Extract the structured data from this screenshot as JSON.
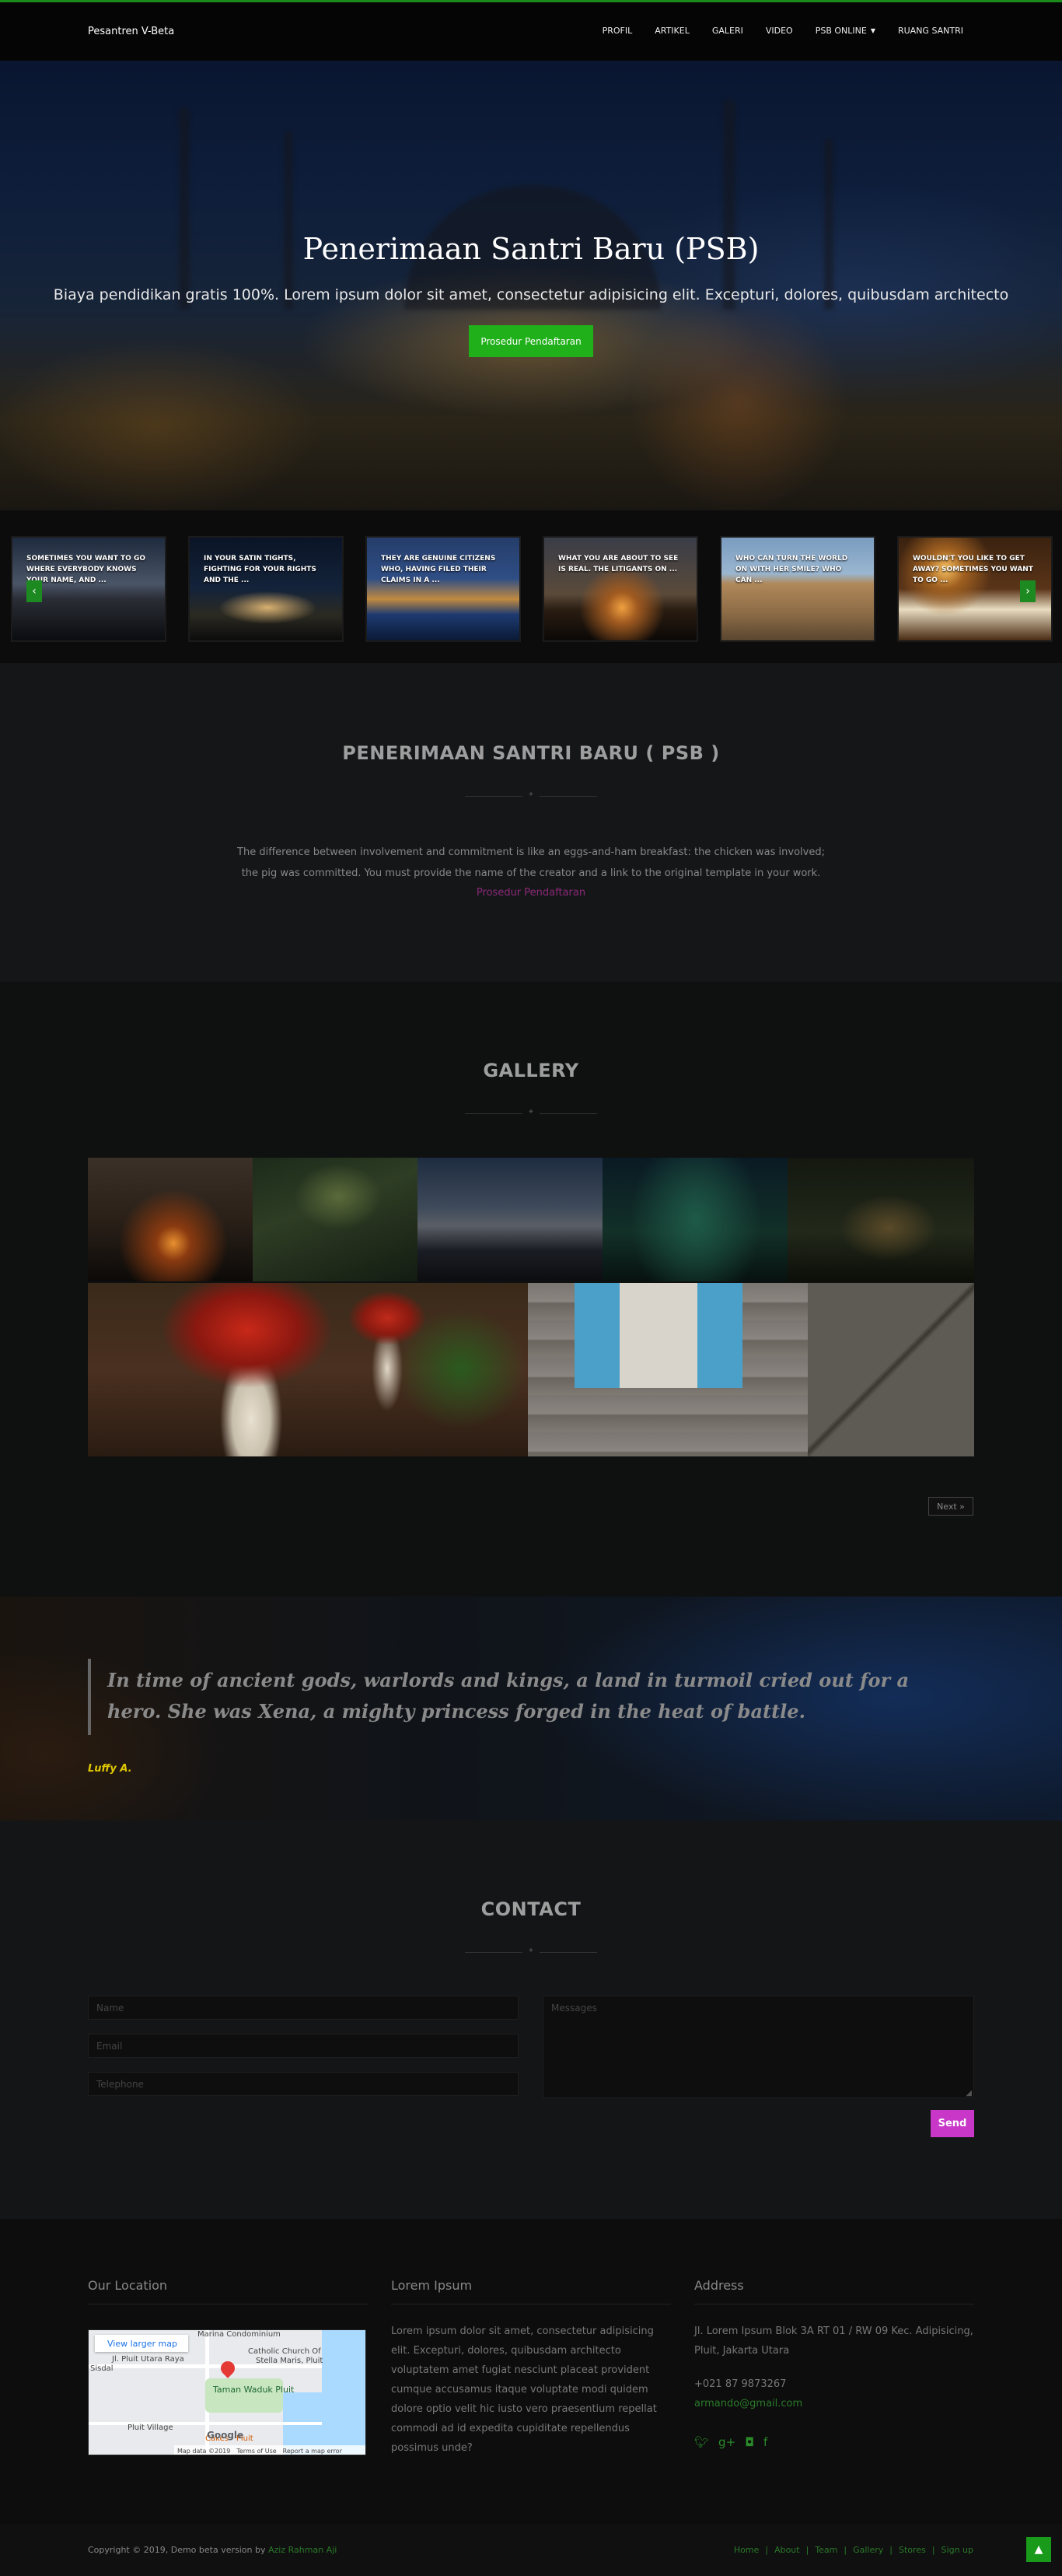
{
  "navbar": {
    "brand": "Pesantren V-Beta",
    "items": [
      {
        "label": "PROFIL"
      },
      {
        "label": "ARTIKEL"
      },
      {
        "label": "GALERI"
      },
      {
        "label": "VIDEO"
      },
      {
        "label": "PSB ONLINE"
      },
      {
        "label": "RUANG SANTRI"
      }
    ]
  },
  "hero": {
    "title": "Penerimaan Santri Baru (PSB)",
    "subtitle": "Biaya pendidikan gratis 100%. Lorem ipsum dolor sit amet, consectetur adipisicing elit. Excepturi, dolores, quibusdam architecto",
    "button": "Prosedur Pendaftaran"
  },
  "strip": {
    "slides": [
      {
        "caption": "SOMETIMES YOU WANT TO GO WHERE EVERYBODY KNOWS YOUR NAME, AND ..."
      },
      {
        "caption": "IN YOUR SATIN TIGHTS, FIGHTING FOR YOUR RIGHTS AND THE ..."
      },
      {
        "caption": "THEY ARE GENUINE CITIZENS WHO, HAVING FILED THEIR CLAIMS IN A ..."
      },
      {
        "caption": "WHAT YOU ARE ABOUT TO SEE IS REAL. THE LITIGANTS ON ..."
      },
      {
        "caption": "WHO CAN TURN THE WORLD ON WITH HER SMILE? WHO CAN ..."
      },
      {
        "caption": "WOULDN'T YOU LIKE TO GET AWAY? SOMETIMES YOU WANT TO GO ..."
      }
    ]
  },
  "psb": {
    "title": "PENERIMAAN SANTRI BARU ( PSB )",
    "body": "The difference between involvement and commitment is like an eggs-and-ham breakfast: the chicken was involved; the pig was committed. You must provide the name of the creator and a link to the original template in your work.",
    "link": "Prosedur Pendaftaran"
  },
  "gallery": {
    "title": "GALLERY",
    "next": "Next »"
  },
  "quote": {
    "text": "In time of ancient gods, warlords and kings, a land in turmoil cried out for a hero. She was Xena, a mighty princess forged in the heat of battle.",
    "author": "Luffy A."
  },
  "contact": {
    "title": "CONTACT",
    "name_placeholder": "Name",
    "email_placeholder": "Email",
    "telephone_placeholder": "Telephone",
    "message_placeholder": "Messages",
    "send": "Send"
  },
  "footer": {
    "location_title": "Our Location",
    "map": {
      "view_larger": "View larger map",
      "labels": {
        "marina": "Marina Condominium",
        "church": "Catholic Church Of",
        "church2": "Stella Maris, Pluit",
        "street": "Jl. Pluit Utara Raya",
        "park": "Taman Waduk Pluit",
        "village": "Pluit Village",
        "cakes": "Cakes - Pluit",
        "sisdal": "Sisdal",
        "attribution": "Map data ©2019",
        "terms": "Terms of Use",
        "report": "Report a map error",
        "google": "Google"
      }
    },
    "lorem_title": "Lorem Ipsum",
    "lorem_text": "Lorem ipsum dolor sit amet, consectetur adipisicing elit. Excepturi, dolores, quibusdam architecto voluptatem amet fugiat nesciunt placeat provident cumque accusamus itaque voluptate modi quidem dolore optio velit hic iusto vero praesentium repellat commodi ad id expedita cupiditate repellendus possimus unde?",
    "address_title": "Address",
    "address": "Jl. Lorem Ipsum Blok 3A RT 01 / RW 09 Kec. Adipisicing, Pluit, Jakarta Utara",
    "phone": "+021 87 9873267",
    "email": "armando@gmail.com",
    "social_icons": [
      "twitter-icon",
      "google-plus-icon",
      "instagram-icon",
      "facebook-icon"
    ]
  },
  "copyright": {
    "text": "Copyright © 2019, Demo beta version by",
    "author": "Aziz Rahman Aji",
    "links": [
      "Home",
      "About",
      "Team",
      "Gallery",
      "Stores",
      "Sign up"
    ]
  }
}
